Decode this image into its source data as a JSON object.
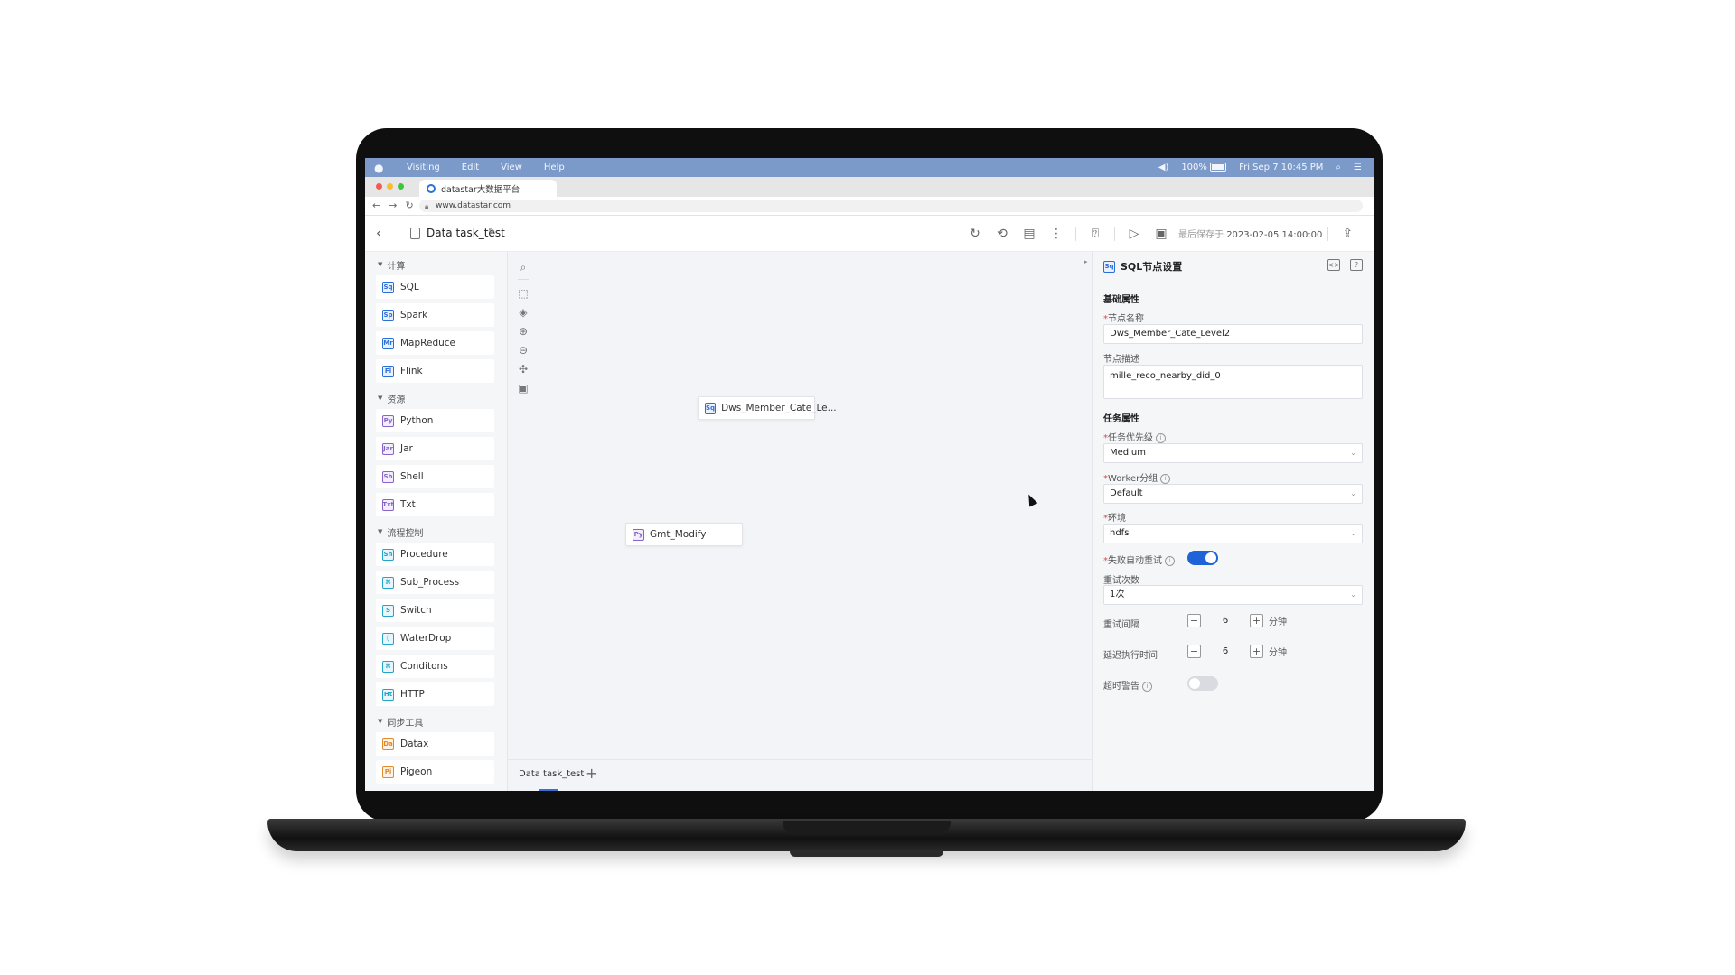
{
  "menubar": {
    "items": [
      "Visiting",
      "Edit",
      "View",
      "Help"
    ],
    "battery": "100%",
    "clock": "Fri Sep 7 10:45 PM"
  },
  "browser": {
    "tab_title": "datastar大数据平台",
    "url": "www.datastar.com"
  },
  "header": {
    "task_title": "Data task_test",
    "saved_prefix": "最后保存于",
    "saved_time": "2023-02-05 14:00:00"
  },
  "palette": {
    "sections": [
      {
        "title": "计算",
        "items": [
          {
            "label": "SQL",
            "badge": "Sq",
            "color": "blue"
          },
          {
            "label": "Spark",
            "badge": "Sp",
            "color": "blue"
          },
          {
            "label": "MapReduce",
            "badge": "Mr",
            "color": "blue"
          },
          {
            "label": "Flink",
            "badge": "Fl",
            "color": "blue"
          }
        ]
      },
      {
        "title": "资源",
        "items": [
          {
            "label": "Python",
            "badge": "Py",
            "color": "purple"
          },
          {
            "label": "Jar",
            "badge": "Jar",
            "color": "purple"
          },
          {
            "label": "Shell",
            "badge": "Sh",
            "color": "purple"
          },
          {
            "label": "Txt",
            "badge": "Txt",
            "color": "purple"
          }
        ]
      },
      {
        "title": "流程控制",
        "items": [
          {
            "label": "Procedure",
            "badge": "Sh",
            "color": "teal"
          },
          {
            "label": "Sub_Process",
            "badge": "⌘",
            "color": "teal"
          },
          {
            "label": "Switch",
            "badge": "S",
            "color": "teal"
          },
          {
            "label": "WaterDrop",
            "badge": "◊",
            "color": "teal"
          },
          {
            "label": "Conditons",
            "badge": "⌘",
            "color": "teal"
          },
          {
            "label": "HTTP",
            "badge": "Ht",
            "color": "teal"
          }
        ]
      },
      {
        "title": "同步工具",
        "items": [
          {
            "label": "Datax",
            "badge": "Da",
            "color": "orange"
          },
          {
            "label": "Pigeon",
            "badge": "Pi",
            "color": "orange"
          }
        ]
      }
    ]
  },
  "canvas": {
    "nodes": [
      {
        "label": "Dws_Member_Cate_Le...",
        "badge": "Sq",
        "color": "blue"
      },
      {
        "label": "Gmt_Modify",
        "badge": "Py",
        "color": "purple"
      }
    ],
    "bottom_tab": "Data task_test",
    "add_tab": "+"
  },
  "panel": {
    "badge": "Sq",
    "title": "SQL节点设置",
    "basic_group": "基础属性",
    "node_name_label": "节点名称",
    "node_name_value": "Dws_Member_Cate_Level2",
    "node_desc_label": "节点描述",
    "node_desc_value": "mille_reco_nearby_did_0",
    "task_group": "任务属性",
    "priority_label": "任务优先级",
    "priority_value": "Medium",
    "worker_label": "Worker分组",
    "worker_value": "Default",
    "env_label": "环境",
    "env_value": "hdfs",
    "retry_label": "失败自动重试",
    "retry_enabled": true,
    "retry_count_label": "重试次数",
    "retry_count_value": "1次",
    "retry_interval_label": "重试间隔",
    "retry_interval_value": "6",
    "delay_label": "延迟执行时间",
    "delay_value": "6",
    "unit": "分钟",
    "timeout_label": "超时警告",
    "timeout_enabled": false,
    "accent": "#1f63d8"
  }
}
